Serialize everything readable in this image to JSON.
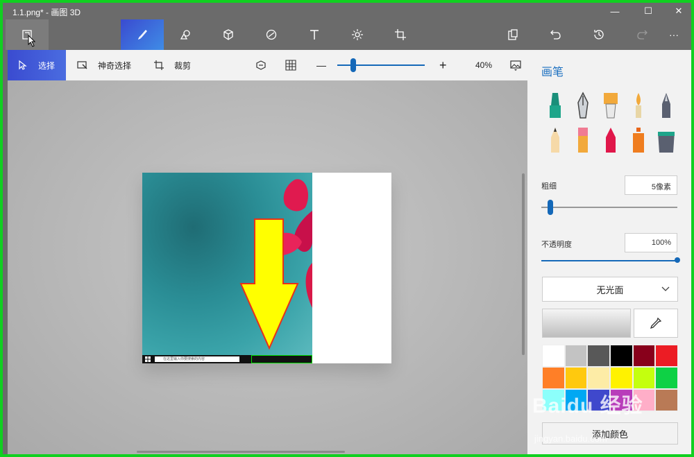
{
  "window": {
    "title": "1.1.png* - 画图 3D",
    "minimize_glyph": "—",
    "maximize_glyph": "☐",
    "close_glyph": "✕"
  },
  "toolbar": {
    "more_glyph": "···"
  },
  "subbar": {
    "select_label": "选择",
    "magic_select_label": "神奇选择",
    "crop_label": "裁剪",
    "zoom_minus": "—",
    "zoom_plus": "+",
    "zoom_value": 0.4,
    "zoom_text": "40%"
  },
  "canvas": {
    "taskbar_search_text": "在这里输入你要搜索的内容"
  },
  "panel": {
    "title": "画笔",
    "thickness_label": "粗细",
    "thickness_value": "5像素",
    "thickness_level": 0.05,
    "opacity_label": "不透明度",
    "opacity_value": "100%",
    "opacity_level": 1.0,
    "finish_value": "无光面",
    "palette_colors": [
      "#ffffff",
      "#c3c3c3",
      "#585858",
      "#000000",
      "#88001b",
      "#ec1c24",
      "#ff7f27",
      "#ffc90e",
      "#fdeca6",
      "#fff200",
      "#c4ff0e",
      "#0ed145",
      "#8cfffb",
      "#00a8f3",
      "#3f48cc",
      "#b83dba",
      "#ffaec8",
      "#b97a56"
    ],
    "add_color_label": "添加颜色"
  },
  "brushes": [
    "marker-icon",
    "calligraphy-pen-icon",
    "oil-brush-icon",
    "watercolor-icon",
    "pixel-pen-icon",
    "pencil-icon",
    "eraser-icon",
    "crayon-icon",
    "spray-can-icon",
    "fill-bucket-icon"
  ],
  "watermark": {
    "logo_text": "Baidu 经验",
    "url_text": "jingyan.baidu.com"
  },
  "colors": {
    "accent_blue": "#1a6fc0",
    "active_gradient_start": "#3a4bd0",
    "highlight_green": "#10d020"
  }
}
